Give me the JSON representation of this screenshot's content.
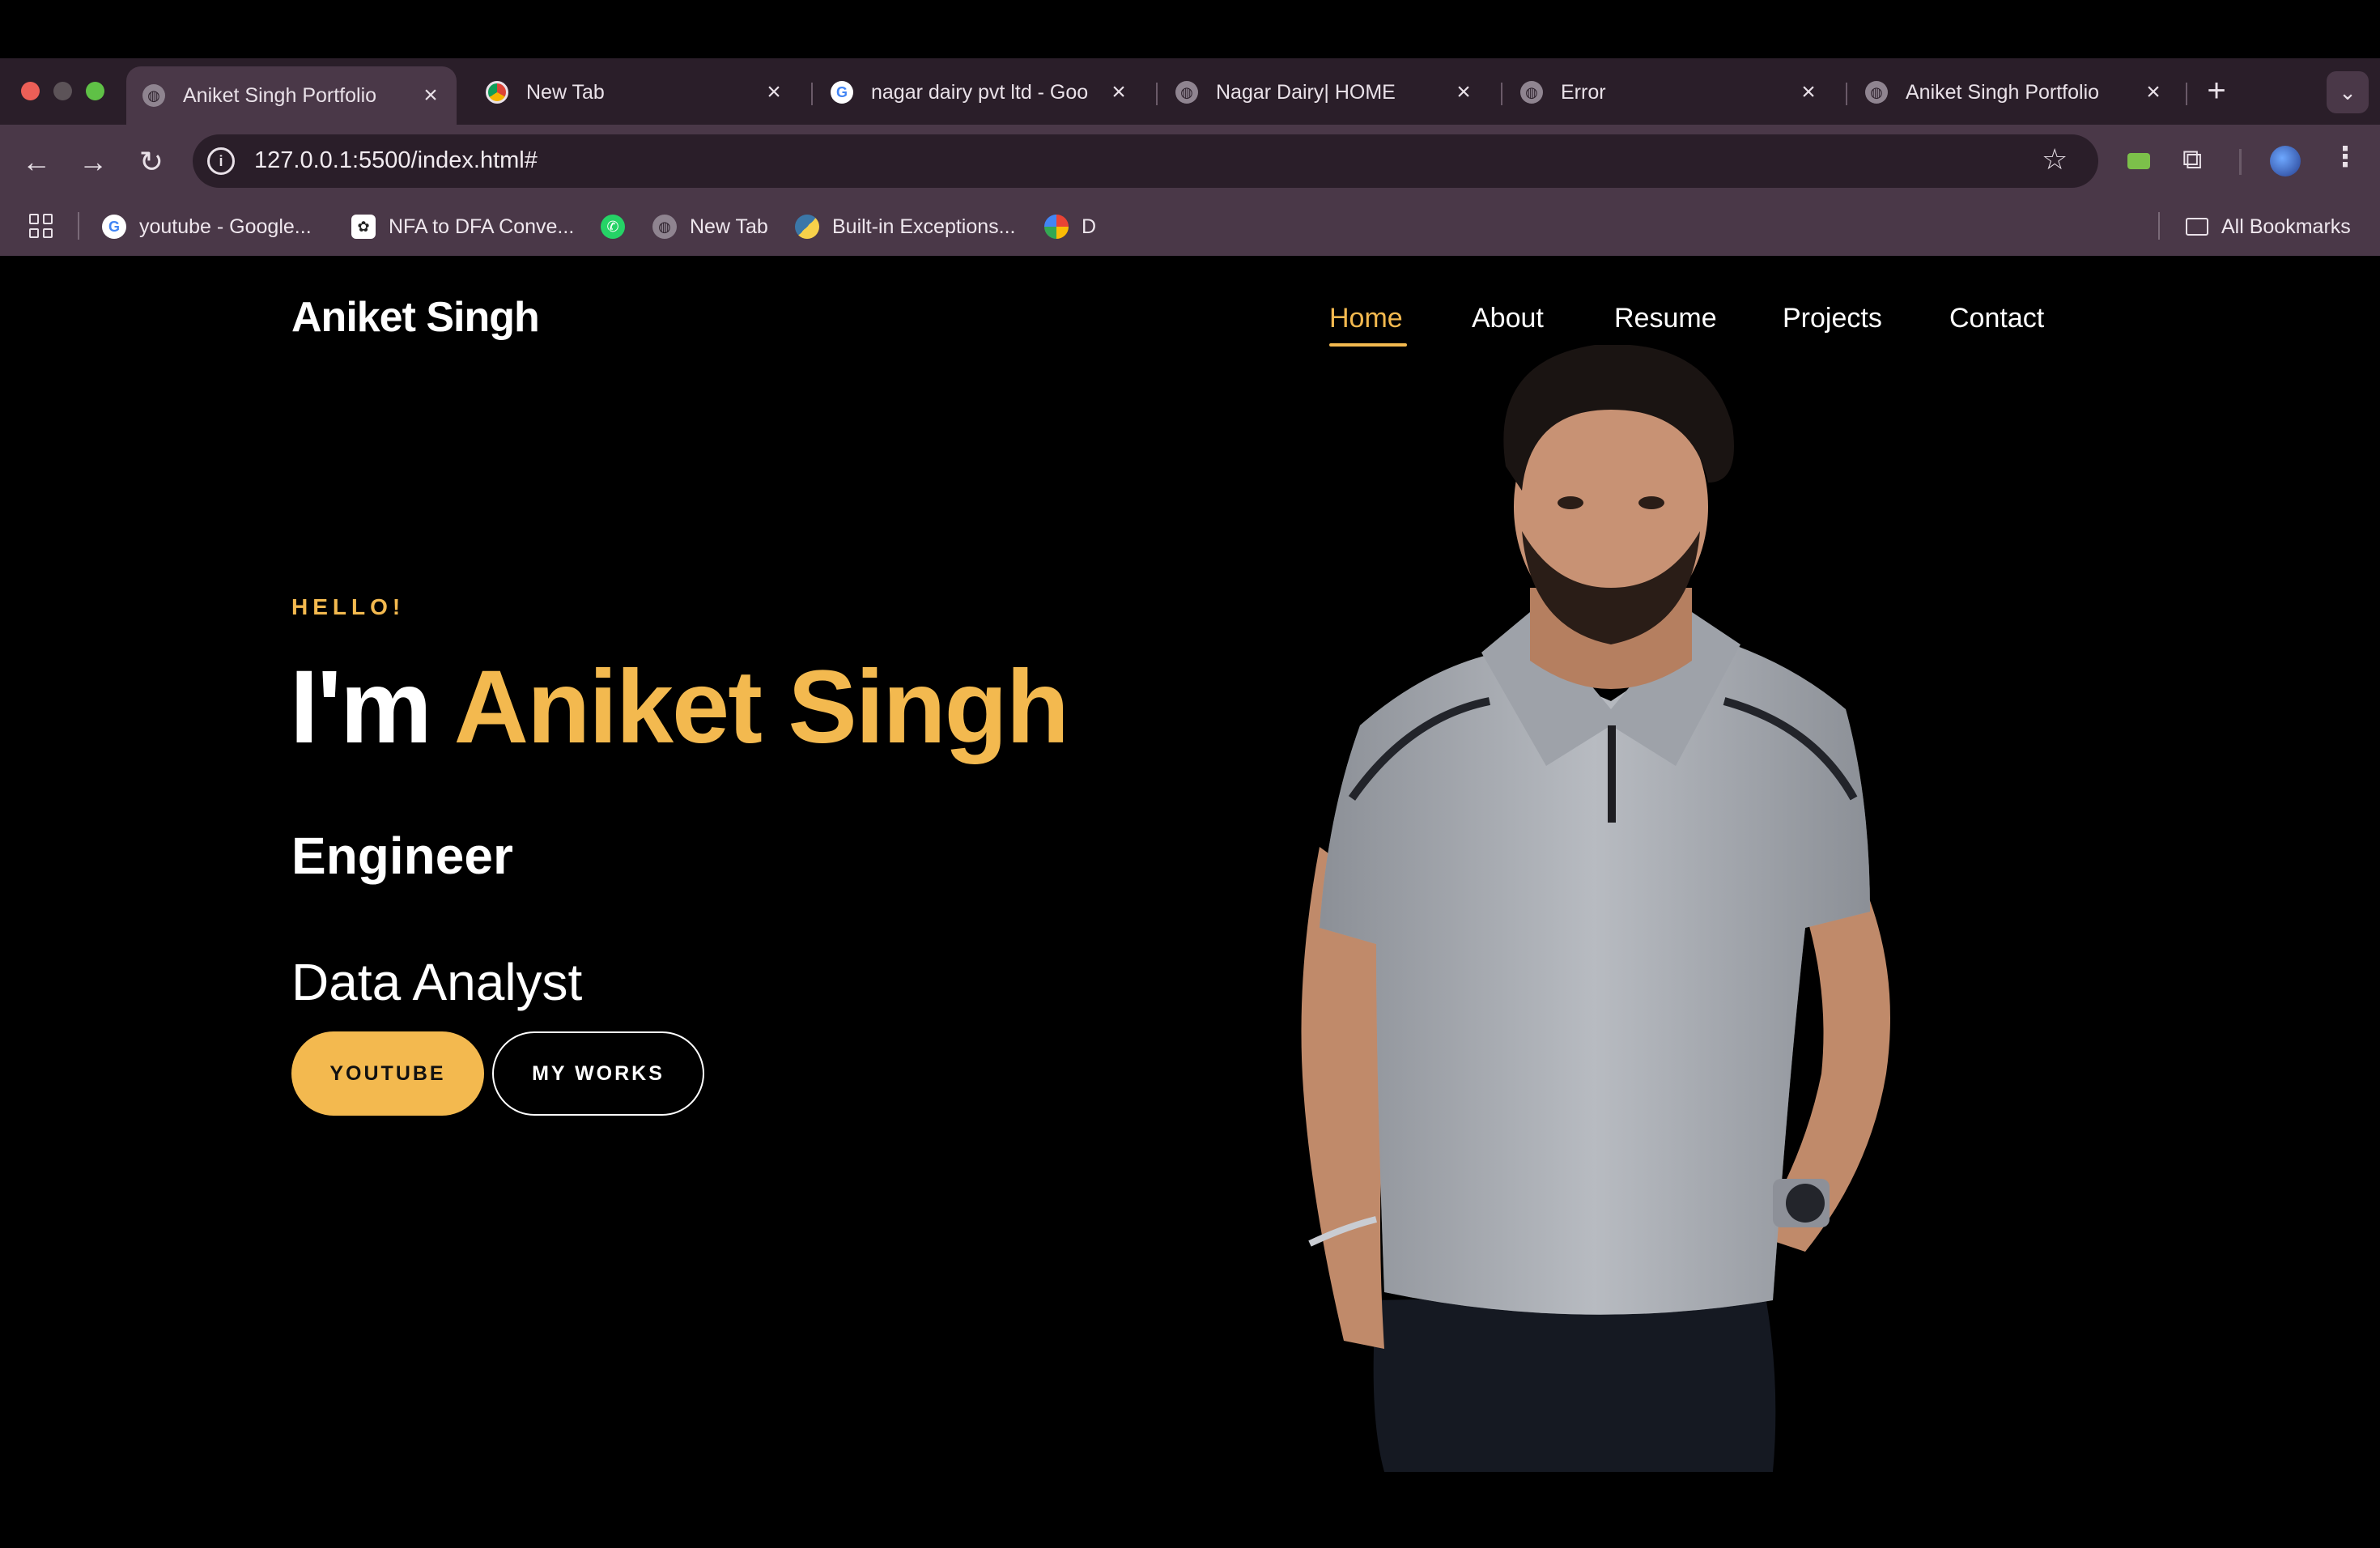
{
  "browser": {
    "tabs": [
      {
        "title": "Aniket Singh Portfolio",
        "favicon": "globe-icon",
        "active": true
      },
      {
        "title": "New Tab",
        "favicon": "chrome-icon",
        "active": false
      },
      {
        "title": "nagar dairy pvt ltd - Goo",
        "favicon": "google-icon",
        "active": false
      },
      {
        "title": "Nagar Dairy| HOME",
        "favicon": "globe-icon",
        "active": false
      },
      {
        "title": "Error",
        "favicon": "globe-icon",
        "active": false
      },
      {
        "title": "Aniket Singh Portfolio",
        "favicon": "globe-icon",
        "active": false
      }
    ],
    "url": "127.0.0.1:5500/index.html#",
    "bookmarks": [
      {
        "label": "youtube - Google...",
        "icon": "google-icon"
      },
      {
        "label": "NFA to DFA Conve...",
        "icon": "openai-icon"
      },
      {
        "label": "",
        "icon": "whatsapp-icon"
      },
      {
        "label": "New Tab",
        "icon": "globe-icon"
      },
      {
        "label": "Built-in Exceptions...",
        "icon": "python-icon"
      },
      {
        "label": "D",
        "icon": "pinwheel-icon"
      }
    ],
    "all_bookmarks_label": "All Bookmarks"
  },
  "site": {
    "brand": "Aniket Singh",
    "nav": [
      "Home",
      "About",
      "Resume",
      "Projects",
      "Contact"
    ],
    "active_nav": "Home",
    "hero": {
      "eyebrow": "HELLO!",
      "headline_prefix": "I'm ",
      "headline_name": "Aniket Singh",
      "role_primary": "Engineer",
      "role_secondary": "Data Analyst",
      "btn_primary": "YOUTUBE",
      "btn_secondary": "MY WORKS"
    }
  },
  "colors": {
    "accent": "#f3b94f",
    "page_bg": "#000000",
    "chrome_dark": "#2a1e29",
    "chrome_light": "#4a3848"
  }
}
